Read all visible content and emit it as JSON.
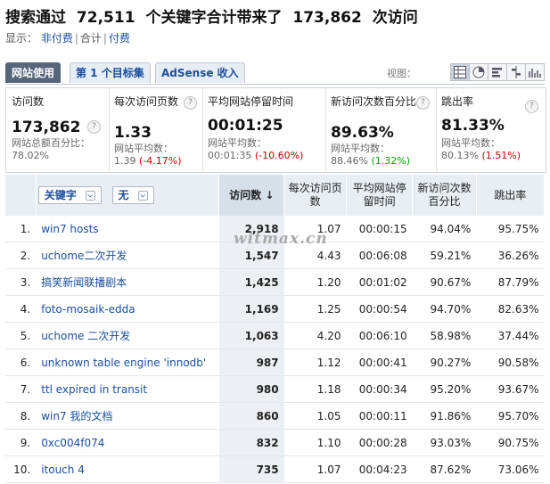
{
  "header": {
    "title_prefix": "搜索通过",
    "keywords_count": "72,511",
    "title_middle": "个关键字合计带来了",
    "visits_count": "173,862",
    "title_suffix": "次访问"
  },
  "display": {
    "label": "显示：",
    "options": [
      "非付费",
      "合计",
      "付费"
    ]
  },
  "tabs": [
    "网站使用",
    "第 1 个目标集",
    "AdSense 收入"
  ],
  "view": {
    "label": "视图：",
    "icons": [
      "table-view-icon",
      "pie-view-icon",
      "bar-view-icon",
      "compare-view-icon",
      "pivot-view-icon"
    ]
  },
  "summary": [
    {
      "label": "访问数",
      "value": "173,862",
      "sub1": "网站总额百分比：",
      "sub2": "78.02%"
    },
    {
      "label": "每次访问页数",
      "value": "1.33",
      "sub1": "网站平均数：",
      "sub2_base": "1.39",
      "sub2_delta": "(-4.17%)"
    },
    {
      "label": "平均网站停留时间",
      "value": "00:01:25",
      "sub1": "网站平均数：",
      "sub2_base": "00:01:35",
      "sub2_delta": "(-10.60%)"
    },
    {
      "label": "新访问次数百分比",
      "value": "89.63%",
      "sub1": "网站平均数：",
      "sub2_base": "88.46%",
      "sub2_delta": "(1.32%)"
    },
    {
      "label": "跳出率",
      "value": "81.33%",
      "sub1": "网站平均数：",
      "sub2_base": "80.13%",
      "sub2_delta": "(1.51%)"
    }
  ],
  "table": {
    "dim1": "关键字",
    "dim2": "无",
    "columns": [
      "访问数",
      "每次访问页数",
      "平均网站停留时间",
      "新访问次数百分比",
      "跳出率"
    ],
    "rows": [
      {
        "i": "1.",
        "kw": "win7 hosts",
        "visits": "2,918",
        "pages": "1.07",
        "time": "00:00:15",
        "newp": "94.04%",
        "bounce": "95.75%"
      },
      {
        "i": "2.",
        "kw": "uchome二次开发",
        "visits": "1,547",
        "pages": "4.43",
        "time": "00:06:08",
        "newp": "59.21%",
        "bounce": "36.26%"
      },
      {
        "i": "3.",
        "kw": "搞笑新闻联播剧本",
        "visits": "1,425",
        "pages": "1.20",
        "time": "00:01:02",
        "newp": "90.67%",
        "bounce": "87.79%"
      },
      {
        "i": "4.",
        "kw": "foto-mosaik-edda",
        "visits": "1,169",
        "pages": "1.25",
        "time": "00:00:54",
        "newp": "94.70%",
        "bounce": "82.63%"
      },
      {
        "i": "5.",
        "kw": "uchome 二次开发",
        "visits": "1,063",
        "pages": "4.20",
        "time": "00:06:10",
        "newp": "58.98%",
        "bounce": "37.44%"
      },
      {
        "i": "6.",
        "kw": "unknown table engine 'innodb'",
        "visits": "987",
        "pages": "1.12",
        "time": "00:00:41",
        "newp": "90.27%",
        "bounce": "90.58%"
      },
      {
        "i": "7.",
        "kw": "ttl expired in transit",
        "visits": "980",
        "pages": "1.18",
        "time": "00:00:34",
        "newp": "95.20%",
        "bounce": "93.67%"
      },
      {
        "i": "8.",
        "kw": "win7 我的文档",
        "visits": "860",
        "pages": "1.05",
        "time": "00:00:11",
        "newp": "91.86%",
        "bounce": "95.70%"
      },
      {
        "i": "9.",
        "kw": "0xc004f074",
        "visits": "832",
        "pages": "1.10",
        "time": "00:00:28",
        "newp": "93.03%",
        "bounce": "90.75%"
      },
      {
        "i": "10.",
        "kw": "itouch 4",
        "visits": "735",
        "pages": "1.07",
        "time": "00:04:23",
        "newp": "87.62%",
        "bounce": "73.06%"
      }
    ]
  },
  "watermark": "witmax.cn"
}
